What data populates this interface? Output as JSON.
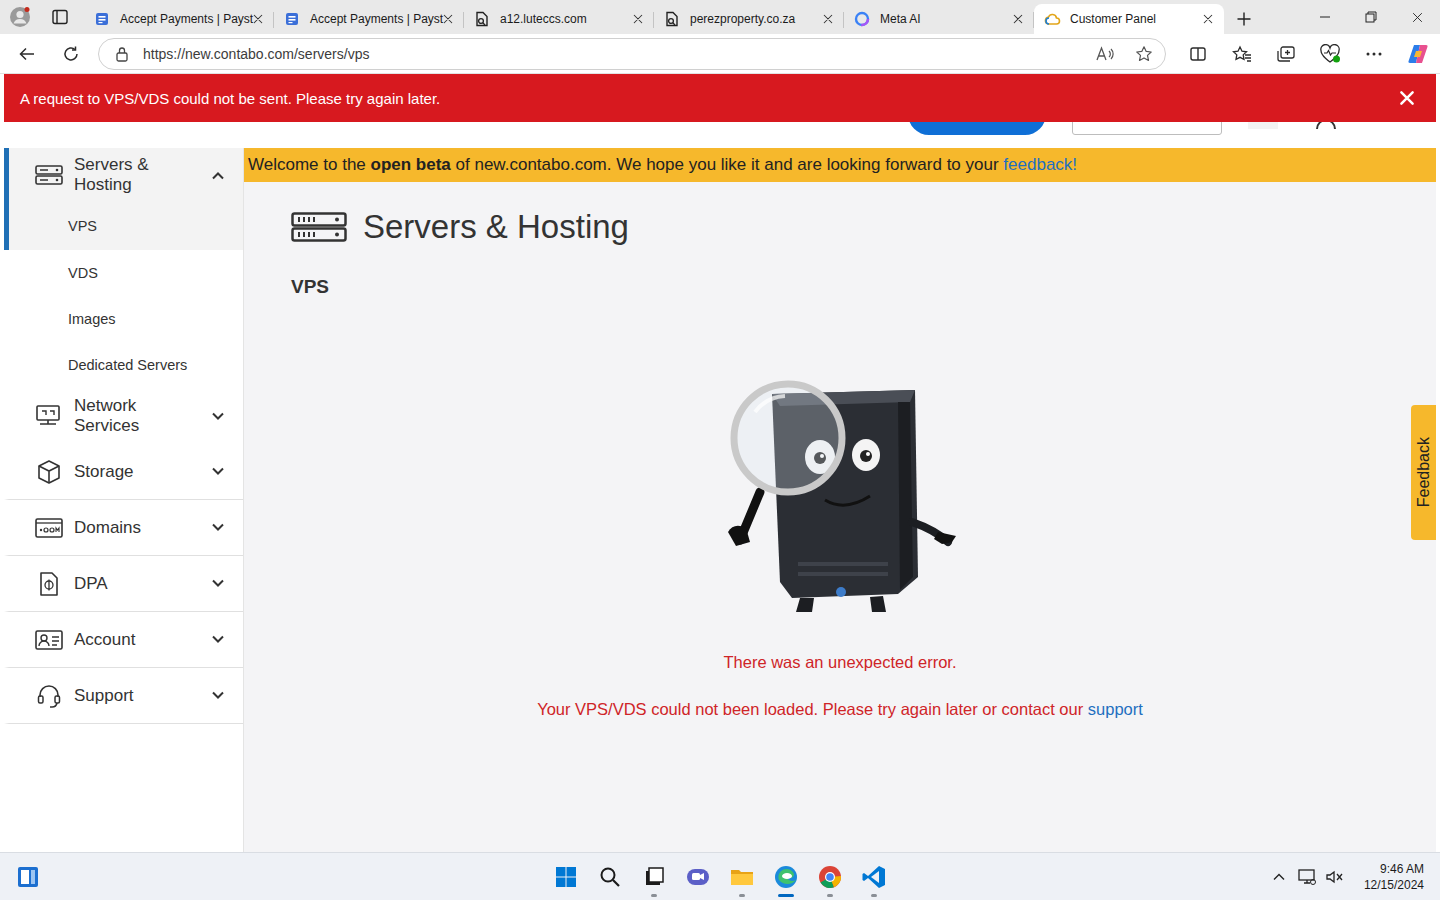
{
  "browser": {
    "tabs": [
      {
        "label": "Accept Payments | Payst",
        "selected": false,
        "kind": "page"
      },
      {
        "label": "Accept Payments | Payst",
        "selected": false,
        "kind": "page"
      },
      {
        "label": "a12.luteccs.com",
        "selected": false,
        "kind": "file"
      },
      {
        "label": "perezproperty.co.za",
        "selected": false,
        "kind": "file"
      },
      {
        "label": "Meta AI",
        "selected": false,
        "kind": "meta"
      },
      {
        "label": "Customer Panel",
        "selected": true,
        "kind": "cloud"
      }
    ],
    "address": "https://new.contabo.com/servers/vps"
  },
  "alert": {
    "message": "A request to VPS/VDS could not be sent. Please try again later."
  },
  "beta_banner": {
    "parts": [
      {
        "text": "Welcome to the ",
        "kind": "plain"
      },
      {
        "text": "open beta",
        "kind": "bold"
      },
      {
        "text": " of new.contabo.com. We hope you like it and are looking forward to your ",
        "kind": "plain"
      },
      {
        "text": "feedback!",
        "kind": "link"
      }
    ]
  },
  "sidebar": {
    "items": [
      {
        "label": "Servers & Hosting",
        "expanded": true,
        "selected": true,
        "children": [
          {
            "label": "VPS",
            "selected": true
          },
          {
            "label": "VDS",
            "selected": false
          },
          {
            "label": "Images",
            "selected": false
          },
          {
            "label": "Dedicated Servers",
            "selected": false
          }
        ]
      },
      {
        "label": "Network Services",
        "expanded": false,
        "selected": false,
        "children": []
      },
      {
        "label": "Storage",
        "expanded": false,
        "selected": false,
        "children": []
      },
      {
        "label": "Domains",
        "expanded": false,
        "selected": false,
        "children": []
      },
      {
        "label": "DPA",
        "expanded": false,
        "selected": false,
        "children": []
      },
      {
        "label": "Account",
        "expanded": false,
        "selected": false,
        "children": []
      },
      {
        "label": "Support",
        "expanded": false,
        "selected": false,
        "children": []
      }
    ]
  },
  "page": {
    "title": "Servers & Hosting",
    "subtitle": "VPS",
    "error_title": "There was an unexpected error.",
    "error_text": "Your VPS/VDS could not been loaded. Please try again later or contact our ",
    "error_link": "support"
  },
  "feedback_tab": "Feedback",
  "taskbar": {
    "time": "9:46 AM",
    "date": "12/15/2024"
  }
}
